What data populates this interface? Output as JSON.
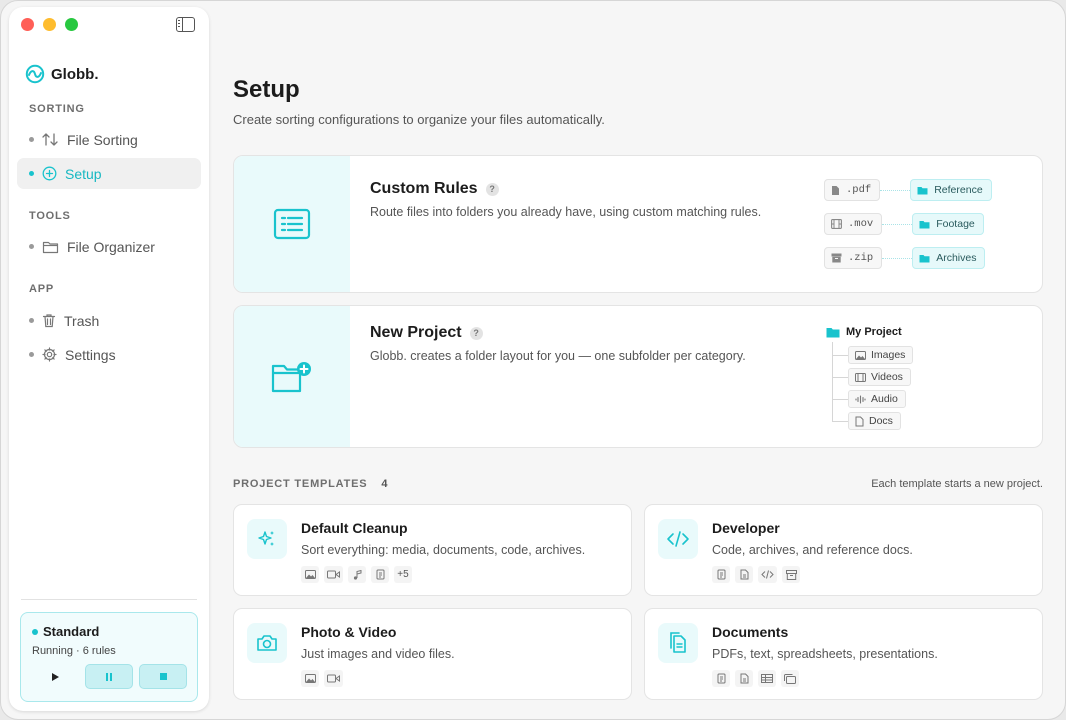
{
  "app": {
    "name": "Globb."
  },
  "colors": {
    "accent": "#19c3cd",
    "accent_soft": "#e9fafb",
    "text": "#1c1c1c",
    "muted": "#555555"
  },
  "sidebar": {
    "sections": [
      {
        "label": "SORTING",
        "items": [
          {
            "label": "File Sorting",
            "icon": "sort-arrows-icon"
          },
          {
            "label": "Setup",
            "icon": "plus-circle-icon",
            "active": true
          }
        ]
      },
      {
        "label": "TOOLS",
        "items": [
          {
            "label": "File Organizer",
            "icon": "folder-icon"
          }
        ]
      },
      {
        "label": "APP",
        "items": [
          {
            "label": "Trash",
            "icon": "trash-icon"
          },
          {
            "label": "Settings",
            "icon": "gear-icon"
          }
        ]
      }
    ],
    "profile": {
      "name": "Standard",
      "status": "Running · 6 rules"
    }
  },
  "main": {
    "title": "Setup",
    "subtitle": "Create sorting configurations to organize your files automatically.",
    "custom_rules": {
      "title": "Custom Rules",
      "help": "?",
      "description": "Route files into folders you already have, using custom matching rules.",
      "rules": [
        {
          "ext": ".pdf",
          "folder": "Reference",
          "icon": "document-icon"
        },
        {
          "ext": ".mov",
          "folder": "Footage",
          "icon": "film-icon"
        },
        {
          "ext": ".zip",
          "folder": "Archives",
          "icon": "archive-icon"
        }
      ]
    },
    "new_project": {
      "title": "New Project",
      "help": "?",
      "description": "Globb. creates a folder layout for you — one subfolder per category.",
      "root": "My Project",
      "children": [
        {
          "label": "Images",
          "icon": "image-icon"
        },
        {
          "label": "Videos",
          "icon": "film-icon"
        },
        {
          "label": "Audio",
          "icon": "waveform-icon"
        },
        {
          "label": "Docs",
          "icon": "document-icon"
        }
      ]
    },
    "templates": {
      "header": "PROJECT TEMPLATES",
      "count": "4",
      "note": "Each template starts a new project.",
      "items": [
        {
          "title": "Default Cleanup",
          "description": "Sort everything: media, documents, code, archives.",
          "icon": "sparkles-icon",
          "badges": [
            "image-icon",
            "video-icon",
            "music-icon",
            "document-icon"
          ],
          "extra": "+5"
        },
        {
          "title": "Developer",
          "description": "Code, archives, and reference docs.",
          "icon": "code-icon",
          "badges": [
            "document-icon",
            "file-icon",
            "code-icon",
            "archive-icon"
          ]
        },
        {
          "title": "Photo & Video",
          "description": "Just images and video files.",
          "icon": "camera-icon",
          "badges": [
            "image-icon",
            "video-icon"
          ]
        },
        {
          "title": "Documents",
          "description": "PDFs, text, spreadsheets, presentations.",
          "icon": "documents-icon",
          "badges": [
            "document-icon",
            "file-icon",
            "table-icon",
            "slides-icon"
          ]
        }
      ]
    }
  }
}
